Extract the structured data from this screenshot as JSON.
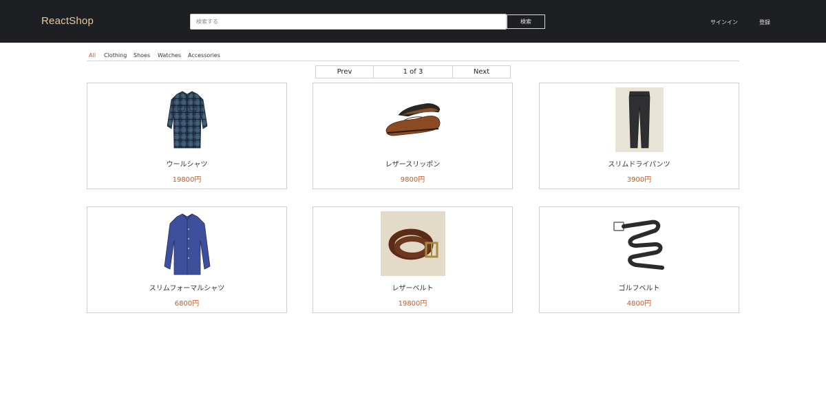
{
  "header": {
    "brand": "ReactShop",
    "search_placeholder": "検索する",
    "search_value": "",
    "search_button": "検索",
    "signin": "サインイン",
    "register": "登録"
  },
  "categories": [
    {
      "label": "All",
      "active": true
    },
    {
      "label": "Clothing",
      "active": false
    },
    {
      "label": "Shoes",
      "active": false
    },
    {
      "label": "Watches",
      "active": false
    },
    {
      "label": "Accessories",
      "active": false
    }
  ],
  "pagination": {
    "prev": "Prev",
    "info": "1 of 3",
    "next": "Next"
  },
  "products": [
    {
      "name": "ウールシャツ",
      "price": "19800円",
      "image_icon": "wool-shirt-image"
    },
    {
      "name": "レザースリッポン",
      "price": "9800円",
      "image_icon": "leather-slip-on-image"
    },
    {
      "name": "スリムドライパンツ",
      "price": "3900円",
      "image_icon": "slim-dry-pants-image"
    },
    {
      "name": "スリムフォーマルシャツ",
      "price": "6800円",
      "image_icon": "slim-formal-shirt-image"
    },
    {
      "name": "レザーベルト",
      "price": "19800円",
      "image_icon": "leather-belt-image"
    },
    {
      "name": "ゴルフベルト",
      "price": "4800円",
      "image_icon": "golf-belt-image"
    }
  ],
  "colors": {
    "header_bg": "#1e1f22",
    "brand": "#e8c9a0",
    "active_category": "#d0522a",
    "price": "#c35a22"
  }
}
